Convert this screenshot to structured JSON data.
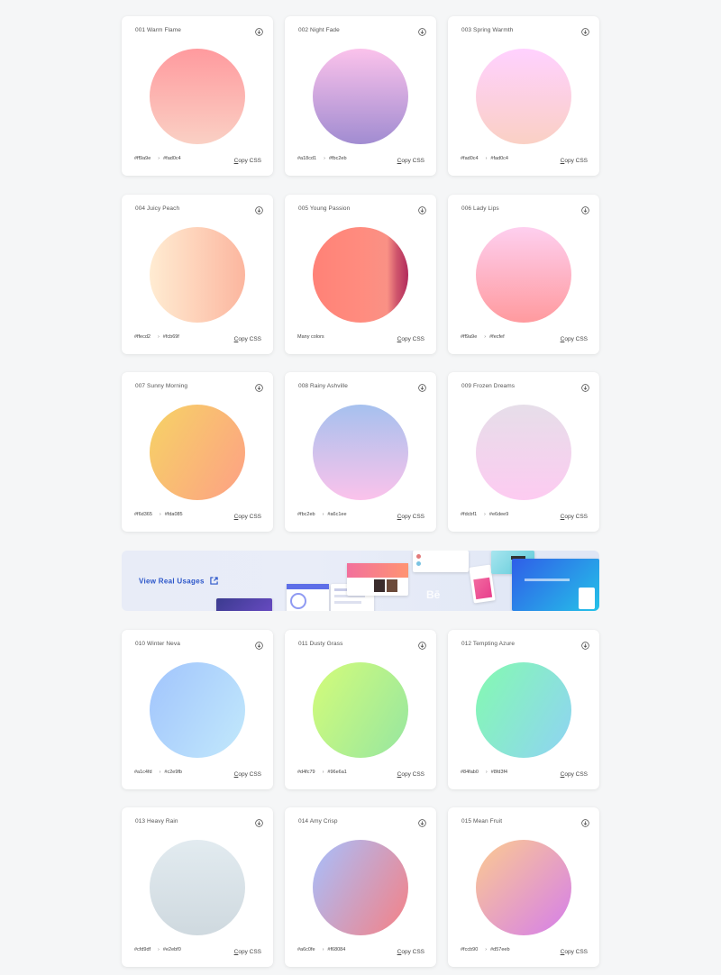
{
  "copy_label_first": "C",
  "copy_label_rest": "opy CSS",
  "banner": {
    "label": "View Real Usages",
    "behance_text": "Bē"
  },
  "rows": [
    [
      {
        "title": "001 Warm Flame",
        "c1": "#ff9a9e",
        "c2": "#fad0c4",
        "angle": "180deg",
        "codes": {
          "from": "#ff9a9e",
          "to": "#fad0c4"
        }
      },
      {
        "title": "002 Night Fade",
        "c1": "#fbc2eb",
        "c2": "#a18cd1",
        "angle": "180deg",
        "codes": {
          "from": "#a18cd1",
          "to": "#fbc2eb"
        }
      },
      {
        "title": "003 Spring Warmth",
        "c1": "#fad0c4",
        "c2": "#ffd1ff",
        "angle": "0deg",
        "codes": {
          "from": "#fad0c4",
          "to": "#fad0c4"
        }
      }
    ],
    [
      {
        "title": "004 Juicy Peach",
        "c1": "#ffecd2",
        "c2": "#fcb69f",
        "angle": "90deg",
        "codes": {
          "from": "#ffecd2",
          "to": "#fcb69f"
        }
      },
      {
        "title": "005 Young Passion",
        "special": "passion",
        "codes_text": "Many colors"
      },
      {
        "title": "006 Lady Lips",
        "c1": "#ff9a9e",
        "c2": "#fecfef",
        "angle": "0deg",
        "codes": {
          "from": "#ff9a9e",
          "to": "#fecfef"
        }
      }
    ],
    [
      {
        "title": "007 Sunny Morning",
        "c1": "#f6d365",
        "c2": "#fda085",
        "angle": "120deg",
        "codes": {
          "from": "#f6d365",
          "to": "#fda085"
        }
      },
      {
        "title": "008 Rainy Ashville",
        "c1": "#fbc2eb",
        "c2": "#a6c1ee",
        "angle": "0deg",
        "codes": {
          "from": "#fbc2eb",
          "to": "#a6c1ee"
        }
      },
      {
        "title": "009 Frozen Dreams",
        "c1": "#fdcbf1",
        "c2": "#e6dee9",
        "angle": "0deg",
        "codes": {
          "from": "#fdcbf1",
          "to": "#e6dee9"
        }
      }
    ],
    [
      {
        "title": "010 Winter Neva",
        "c1": "#a1c4fd",
        "c2": "#c2e9fb",
        "angle": "120deg",
        "codes": {
          "from": "#a1c4fd",
          "to": "#c2e9fb"
        }
      },
      {
        "title": "011 Dusty Grass",
        "c1": "#d4fc79",
        "c2": "#96e6a1",
        "angle": "120deg",
        "codes": {
          "from": "#d4fc79",
          "to": "#96e6a1"
        }
      },
      {
        "title": "012 Tempting Azure",
        "c1": "#84fab0",
        "c2": "#8fd3f4",
        "angle": "120deg",
        "codes": {
          "from": "#84fab0",
          "to": "#8fd3f4"
        }
      }
    ],
    [
      {
        "title": "013 Heavy Rain",
        "c1": "#cfd9df",
        "c2": "#e2ebf0",
        "angle": "0deg",
        "codes": {
          "from": "#cfd9df",
          "to": "#e2ebf0"
        }
      },
      {
        "title": "014 Amy Crisp",
        "c1": "#a6c0fe",
        "c2": "#f68084",
        "angle": "120deg",
        "codes": {
          "from": "#a6c0fe",
          "to": "#f68084"
        }
      },
      {
        "title": "015 Mean Fruit",
        "c1": "#fccb90",
        "c2": "#d57eeb",
        "angle": "135deg",
        "codes": {
          "from": "#fccb90",
          "to": "#d57eeb"
        }
      }
    ]
  ]
}
